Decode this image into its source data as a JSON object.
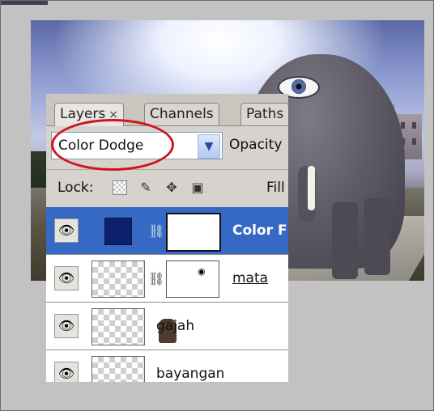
{
  "panel": {
    "tabs": [
      {
        "label": "Layers",
        "close": "×"
      },
      {
        "label": "Channels"
      },
      {
        "label": "Paths"
      }
    ],
    "blend_mode": "Color Dodge",
    "opacity_label": "Opacity",
    "lock_label": "Lock:",
    "fill_label": "Fill",
    "lock_icons": [
      "transparency-lock-icon",
      "brush-lock-icon",
      "move-lock-icon",
      "padlock-icon"
    ],
    "layers": [
      {
        "name": "Color F",
        "selected": true,
        "type": "adjustment",
        "swatch_color": "#0e1f6b"
      },
      {
        "name": "mata",
        "selected": false,
        "type": "masked"
      },
      {
        "name": "gajah",
        "selected": false,
        "type": "image"
      },
      {
        "name": "bayangan",
        "selected": false,
        "type": "transparent"
      }
    ]
  },
  "colors": {
    "selection": "#3569c4",
    "highlight_ring": "#d0141d"
  }
}
